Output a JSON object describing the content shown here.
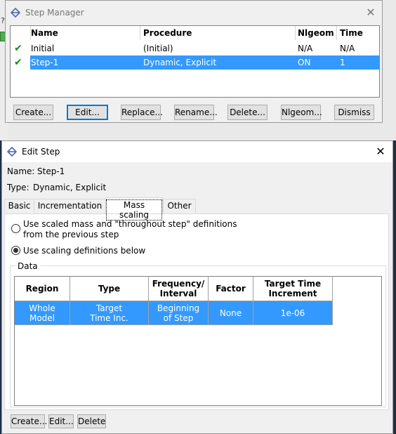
{
  "step_manager": {
    "title": "Step Manager",
    "columns": [
      "Name",
      "Procedure",
      "Nlgeom",
      "Time"
    ],
    "rows": [
      {
        "name": "Initial",
        "procedure": "(Initial)",
        "nlgeom": "N/A",
        "time": "N/A",
        "checked": true,
        "selected": false
      },
      {
        "name": "Step-1",
        "procedure": "Dynamic, Explicit",
        "nlgeom": "ON",
        "time": "1",
        "checked": true,
        "selected": true
      }
    ],
    "buttons": {
      "create": "Create...",
      "edit": "Edit...",
      "replace": "Replace...",
      "rename": "Rename...",
      "delete": "Delete...",
      "nlgeom": "Nlgeom...",
      "dismiss": "Dismiss"
    }
  },
  "edit_step": {
    "title": "Edit Step",
    "name_label": "Name:",
    "name_value": "Step-1",
    "type_label": "Type:",
    "type_value": "Dynamic, Explicit",
    "tabs": [
      "Basic",
      "Incrementation",
      "Mass scaling",
      "Other"
    ],
    "active_tab": "Mass scaling",
    "options": {
      "previous_line1": "Use scaled mass and \"throughout step\" definitions",
      "previous_line2": "from the previous step",
      "below": "Use scaling definitions below",
      "selected": "below"
    },
    "data_group_label": "Data",
    "table": {
      "headers": {
        "region": "Region",
        "type": "Type",
        "frequency_1": "Frequency/",
        "frequency_2": "Interval",
        "factor": "Factor",
        "target_1": "Target Time",
        "target_2": "Increment"
      },
      "row": {
        "region_1": "Whole",
        "region_2": "Model",
        "type_1": "Target",
        "type_2": "Time Inc.",
        "frequency_1": "Beginning",
        "frequency_2": "of Step",
        "factor": "None",
        "target": "1e-06"
      }
    },
    "buttons": {
      "create": "Create...",
      "edit": "Edit...",
      "delete": "Delete"
    }
  },
  "colors": {
    "selection": "#3399ff",
    "check": "#1a8a1a",
    "desktop": "#1f2f47"
  }
}
